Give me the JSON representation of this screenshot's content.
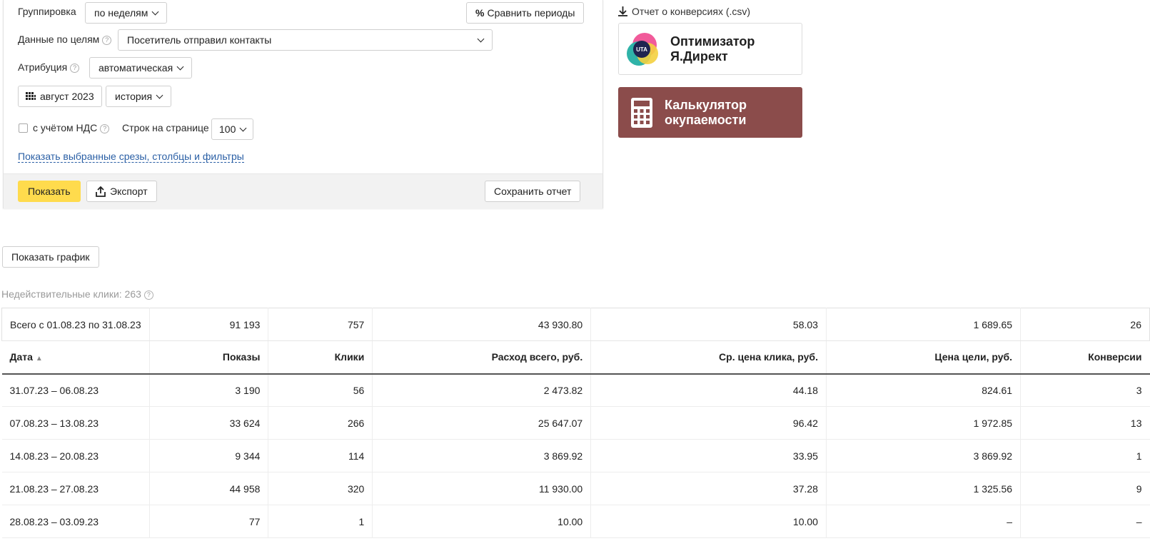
{
  "settings": {
    "grouping_label": "Группировка",
    "grouping_value": "по неделям",
    "compare_label": "Сравнить периоды",
    "goals_label": "Данные по целям",
    "goals_value": "Посетитель отправил контакты",
    "attribution_label": "Атрибуция",
    "attribution_value": "автоматическая",
    "period_value": "август 2023",
    "history_value": "история",
    "vat_label": "с учётом НДС",
    "rows_label": "Строк на странице",
    "rows_value": "100",
    "show_filters_link": "Показать выбранные срезы, столбцы и фильтры"
  },
  "footer": {
    "show_label": "Показать",
    "export_label": "Экспорт",
    "save_label": "Сохранить отчет"
  },
  "sidebar": {
    "csv_link": "Отчет о конверсиях (.csv)",
    "optimizer_logo_text": "UTA",
    "optimizer_title_1": "Оптимизатор",
    "optimizer_title_2": "Я.Директ",
    "calc_title_1": "Калькулятор",
    "calc_title_2": "окупаемости"
  },
  "show_chart_label": "Показать график",
  "invalid_clicks": "Недействительные клики: 263",
  "table": {
    "total": [
      "Всего с 01.08.23 по 31.08.23",
      "91 193",
      "757",
      "43 930.80",
      "58.03",
      "1 689.65",
      "26"
    ],
    "headers": [
      "Дата",
      "Показы",
      "Клики",
      "Расход всего, руб.",
      "Ср. цена клика, руб.",
      "Цена цели, руб.",
      "Конверсии"
    ],
    "rows": [
      [
        "31.07.23 – 06.08.23",
        "3 190",
        "56",
        "2 473.82",
        "44.18",
        "824.61",
        "3"
      ],
      [
        "07.08.23 – 13.08.23",
        "33 624",
        "266",
        "25 647.07",
        "96.42",
        "1 972.85",
        "13"
      ],
      [
        "14.08.23 – 20.08.23",
        "9 344",
        "114",
        "3 869.92",
        "33.95",
        "3 869.92",
        "1"
      ],
      [
        "21.08.23 – 27.08.23",
        "44 958",
        "320",
        "11 930.00",
        "37.28",
        "1 325.56",
        "9"
      ],
      [
        "28.08.23 – 03.09.23",
        "77",
        "1",
        "10.00",
        "10.00",
        "–",
        "–"
      ]
    ]
  },
  "colors": {
    "accent_yellow": "#ffdb4d",
    "calc_card": "#8b4c4b",
    "link": "#2a5fa5"
  }
}
